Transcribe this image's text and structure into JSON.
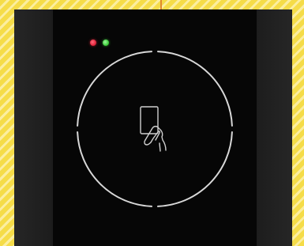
{
  "device": {
    "type": "nfc-card-reader",
    "icon": "tap-card-icon",
    "indicators": [
      {
        "name": "status-led-red",
        "color": "#e5263d"
      },
      {
        "name": "status-led-green",
        "color": "#3fcf3c"
      }
    ],
    "ring_color": "#d8d8d8",
    "cable_color": "#e08a2e",
    "background_color": "#f5dc48"
  }
}
